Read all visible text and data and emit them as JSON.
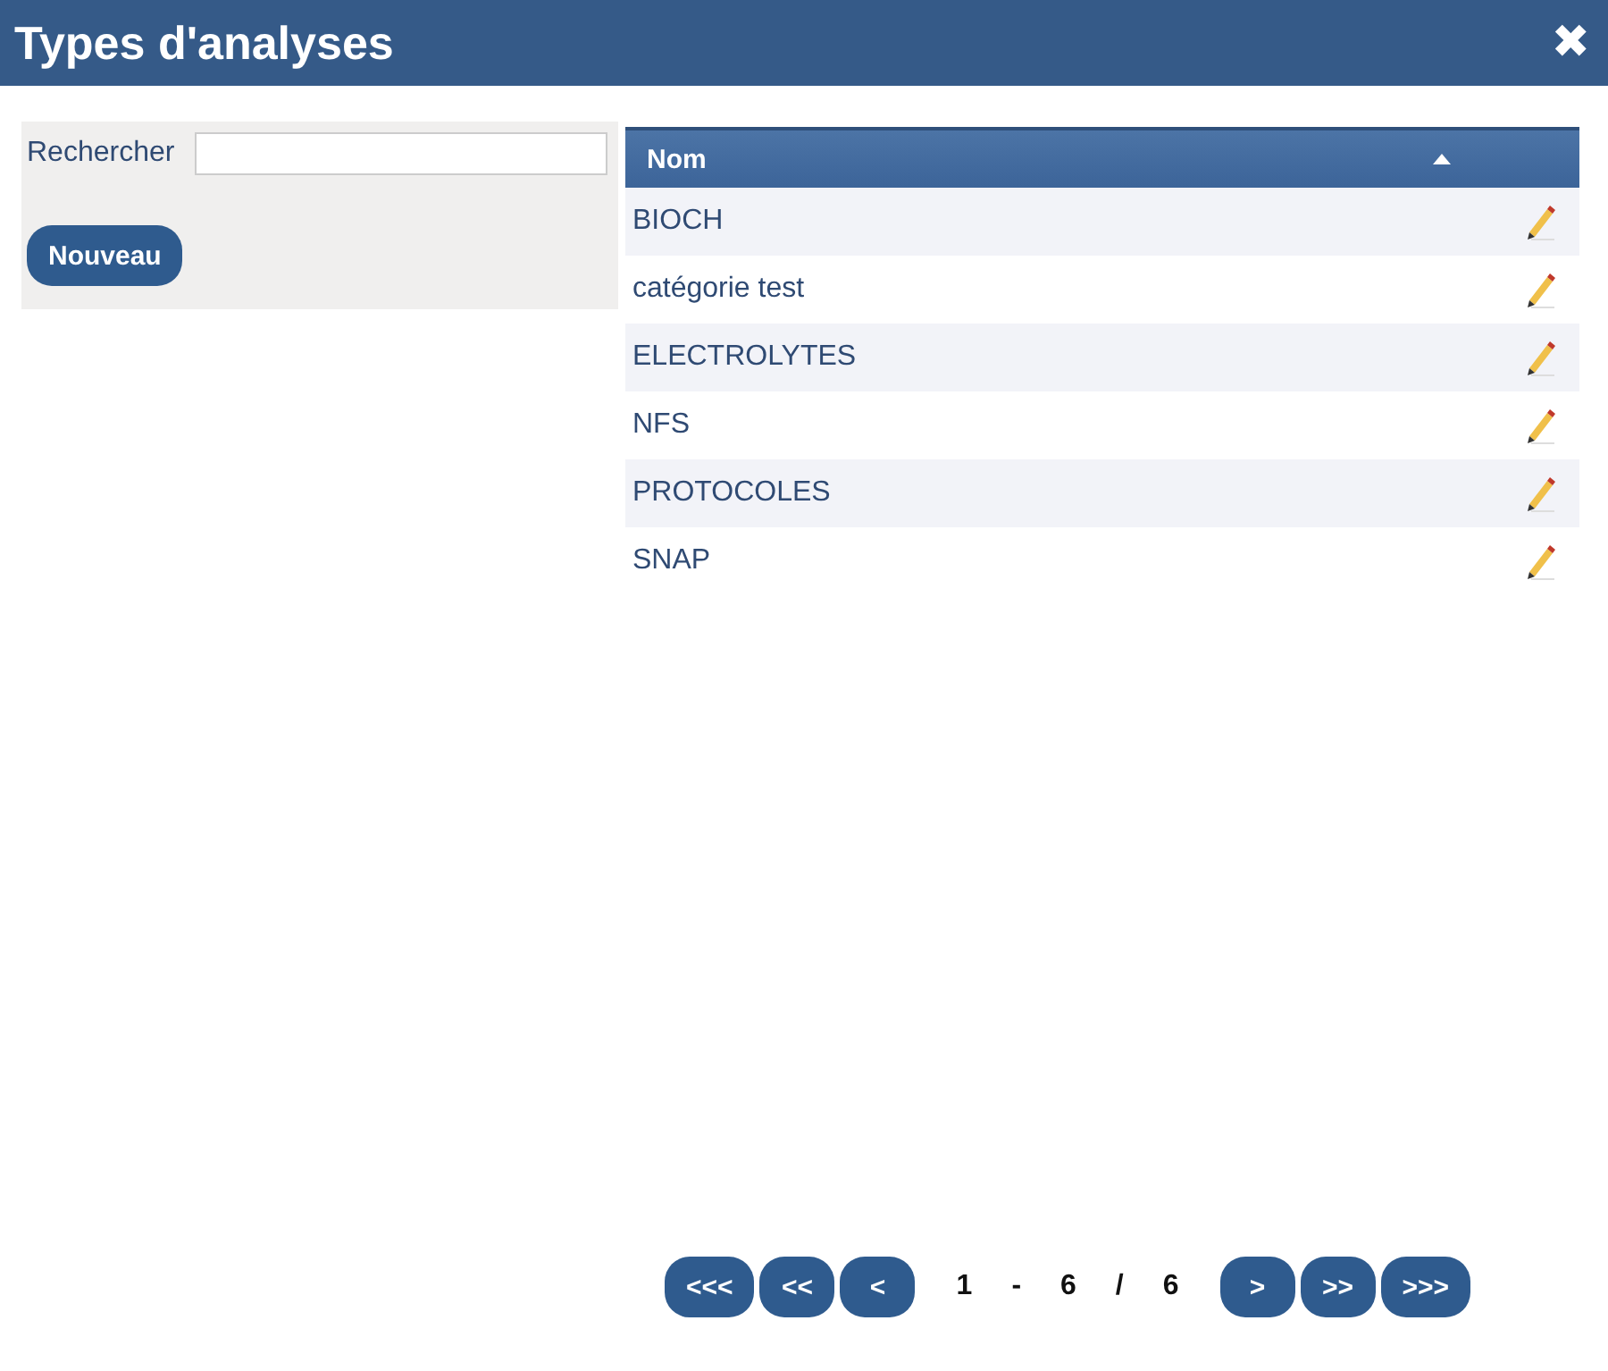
{
  "window": {
    "title": "Types d'analyses",
    "close": "✖"
  },
  "search": {
    "label": "Rechercher"
  },
  "new_button": "Nouveau",
  "table": {
    "columns": [
      {
        "label": "Nom",
        "sorted": true
      }
    ],
    "rows": [
      "BIOCH",
      "catégorie test",
      "ELECTROLYTES",
      "NFS",
      "PROTOCOLES",
      "SNAP"
    ]
  },
  "pager": {
    "first": "<<<",
    "prev_page": "<<",
    "prev": "<",
    "range": [
      "1",
      "-",
      "6",
      "/",
      "6"
    ],
    "next": ">",
    "next_page": ">>",
    "last": ">>>"
  }
}
